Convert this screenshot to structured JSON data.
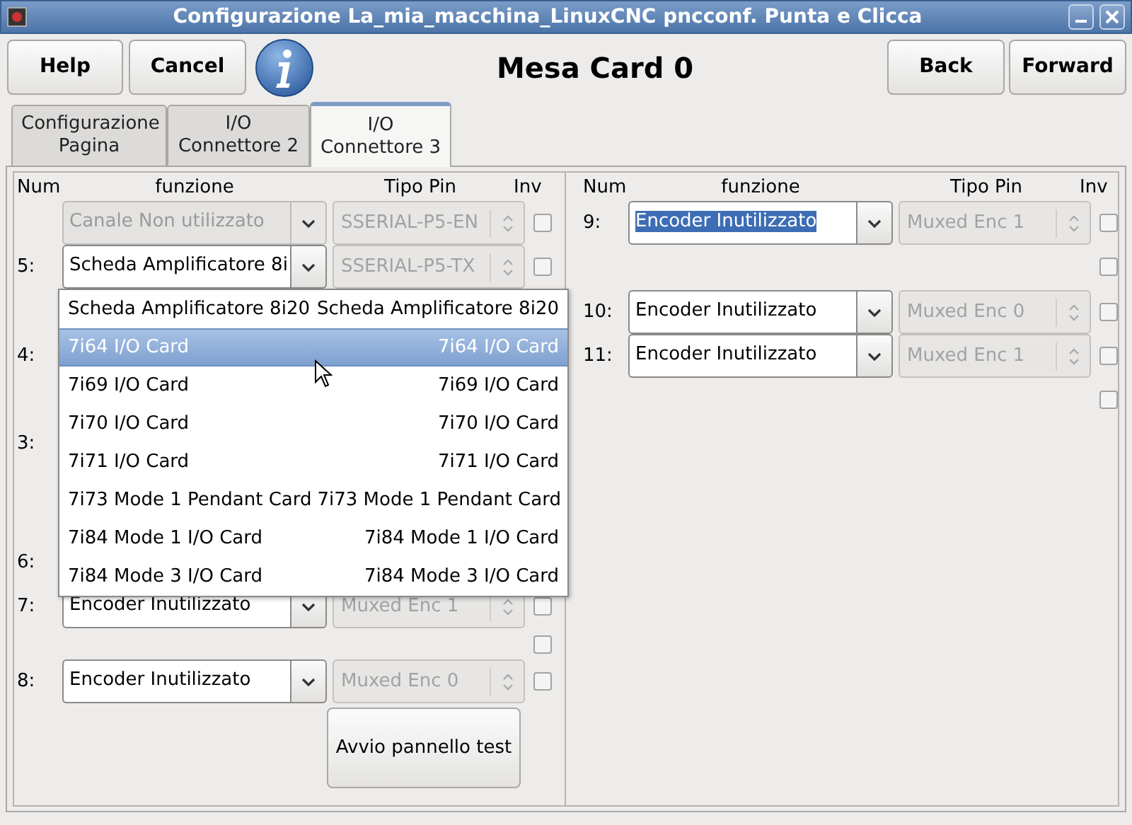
{
  "window": {
    "title": "Configurazione La_mia_macchina_LinuxCNC pncconf. Punta e Clicca"
  },
  "header": {
    "left_buttons": [
      "Help",
      "Cancel"
    ],
    "title": "Mesa Card 0",
    "right_buttons": [
      "Back",
      "Forward"
    ]
  },
  "tabs": [
    {
      "label": "Configurazione\nPagina",
      "selected": false
    },
    {
      "label": "I/O\nConnettore 2",
      "selected": false
    },
    {
      "label": "I/O\nConnettore 3",
      "selected": true
    }
  ],
  "left_panel": {
    "headers": [
      "Num",
      "funzione",
      "Tipo Pin",
      "Inv"
    ],
    "rows": [
      {
        "kind": "full",
        "function": "Canale Non utilizzato",
        "disabled": true,
        "pin_type": "SSERIAL-P5-EN",
        "checked": false
      },
      {
        "kind": "full",
        "num": "5:",
        "function": "Scheda Amplificatore 8i",
        "disabled": false,
        "pin_type": "SSERIAL-P5-TX",
        "checked": false
      },
      {
        "kind": "label",
        "num": "4:"
      },
      {
        "kind": "label",
        "num": "3:"
      },
      {
        "kind": "label",
        "num": "6:"
      },
      {
        "kind": "full",
        "num": "7:",
        "function": "Encoder Inutilizzato",
        "disabled": false,
        "pin_type": "Muxed Enc 1",
        "checked": false
      },
      {
        "kind": "checkbox",
        "checked": false
      },
      {
        "kind": "full",
        "num": "8:",
        "function": "Encoder Inutilizzato",
        "disabled": false,
        "pin_type": "Muxed Enc 0",
        "checked": false
      }
    ],
    "test_button": "Avvio pannello test"
  },
  "right_panel": {
    "headers": [
      "Num",
      "funzione",
      "Tipo Pin",
      "Inv"
    ],
    "rows": [
      {
        "kind": "full",
        "num": "9:",
        "function": "Encoder Inutilizzato",
        "text_selected": true,
        "disabled": false,
        "pin_type": "Muxed Enc 1",
        "checked": false
      },
      {
        "kind": "checkbox",
        "checked": false
      },
      {
        "kind": "full",
        "num": "10:",
        "function": "Encoder Inutilizzato",
        "text_selected": false,
        "disabled": false,
        "pin_type": "Muxed Enc 0",
        "checked": false
      },
      {
        "kind": "full",
        "num": "11:",
        "function": "Encoder Inutilizzato",
        "text_selected": false,
        "disabled": false,
        "pin_type": "Muxed Enc 1",
        "checked": false
      },
      {
        "kind": "checkbox",
        "checked": false
      }
    ]
  },
  "dropdown_menu": {
    "items": [
      {
        "name": "Scheda Amplificatore 8i20",
        "value": "Scheda Amplificatore 8i20",
        "selected": false
      },
      {
        "name": "7i64 I/O Card",
        "value": "7i64 I/O Card",
        "selected": true
      },
      {
        "name": "7i69 I/O Card",
        "value": "7i69 I/O Card",
        "selected": false
      },
      {
        "name": "7i70 I/O Card",
        "value": "7i70 I/O Card",
        "selected": false
      },
      {
        "name": "7i71 I/O Card",
        "value": "7i71 I/O Card",
        "selected": false
      },
      {
        "name": "7i73 Mode 1 Pendant Card",
        "value": "7i73 Mode 1 Pendant Card",
        "selected": false
      },
      {
        "name": "7i84 Mode 1 I/O Card",
        "value": "7i84 Mode 1 I/O Card",
        "selected": false
      },
      {
        "name": "7i84 Mode 3 I/O Card",
        "value": "7i84 Mode 3 I/O Card",
        "selected": false
      }
    ]
  }
}
